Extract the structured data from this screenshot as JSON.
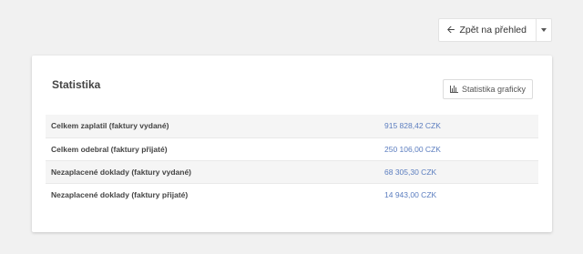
{
  "header": {
    "back_button_label": "Zpět na přehled",
    "back_icon": "arrow-left-icon"
  },
  "card": {
    "title": "Statistika",
    "graph_button_label": "Statistika graficky",
    "graph_icon": "bar-chart-icon",
    "rows": [
      {
        "label": "Celkem zaplatil (faktury vydané)",
        "value": "915 828,42 CZK"
      },
      {
        "label": "Celkem odebral (faktury přijaté)",
        "value": "250 106,00 CZK"
      },
      {
        "label": "Nezaplacené doklady (faktury vydané)",
        "value": "68 305,30 CZK"
      },
      {
        "label": "Nezaplacené doklady (faktury přijaté)",
        "value": "14 943,00 CZK"
      }
    ]
  },
  "colors": {
    "background": "#f1f1f1",
    "value_link": "#5b7dbf",
    "row_stripe": "#f5f5f5"
  }
}
